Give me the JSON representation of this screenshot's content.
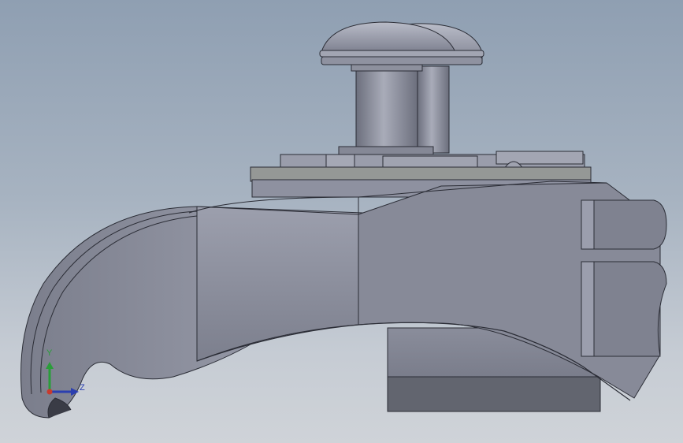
{
  "viewport": {
    "background_top": "#8f9fb2",
    "background_bottom": "#cfd3d8"
  },
  "model": {
    "body_color": "#8c8f9e",
    "edge_color": "#2b2d36"
  },
  "triad": {
    "y_label": "Y",
    "z_label": "Z",
    "y_color": "#2a9d3a",
    "z_color": "#2b3fb0",
    "x_color": "#c83a2e"
  }
}
